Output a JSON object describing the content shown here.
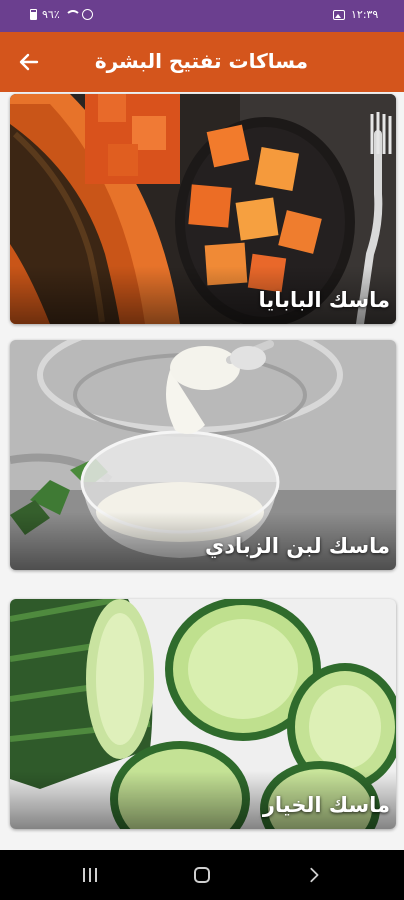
{
  "status_bar": {
    "time": "١٢:٣٩",
    "battery": "٩٦٪"
  },
  "app_bar": {
    "title": "مساكات تفتيح البشرة",
    "back_icon": "arrow-left-icon"
  },
  "cards": [
    {
      "caption": "ماسك البابايا"
    },
    {
      "caption": "ماسك لبن الزبادي"
    },
    {
      "caption": "ماسك الخيار"
    }
  ],
  "nav_bar": {
    "recent_icon": "recent-apps-icon",
    "home_icon": "home-icon",
    "back_icon": "chevron-right-icon"
  },
  "colors": {
    "status_bar": "#6b3f8f",
    "app_bar": "#d4551c",
    "nav_bar": "#000000"
  }
}
